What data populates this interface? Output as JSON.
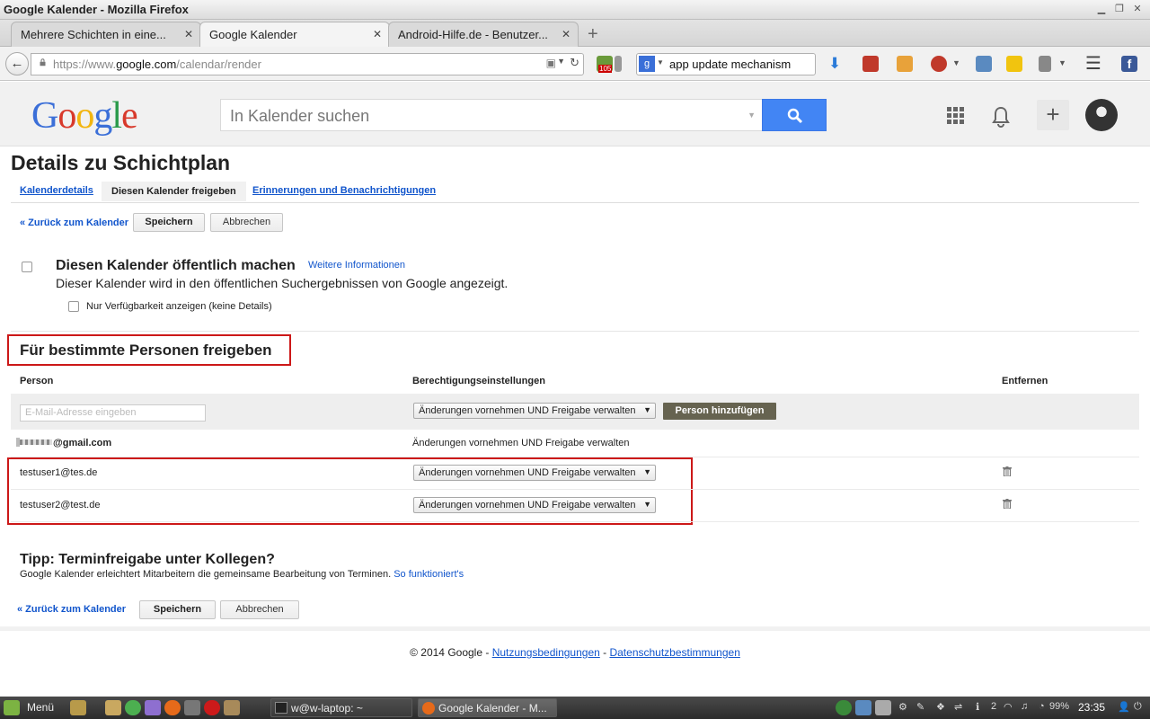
{
  "window": {
    "title": "Google Kalender - Mozilla Firefox"
  },
  "tabs": [
    {
      "label": "Mehrere Schichten in eine...",
      "active": false
    },
    {
      "label": "Google Kalender",
      "active": true
    },
    {
      "label": "Android-Hilfe.de - Benutzer...",
      "active": false
    }
  ],
  "nav": {
    "url_prefix": "https://www.",
    "url_host": "google.com",
    "url_path": "/calendar/render",
    "search_value": "app update mechanism",
    "badge_count": "105"
  },
  "google": {
    "logo": "Google",
    "search_placeholder": "In Kalender suchen"
  },
  "page": {
    "title": "Details zu Schichtplan",
    "tabs": [
      "Kalenderdetails",
      "Diesen Kalender freigeben",
      "Erinnerungen und Benachrichtigungen"
    ],
    "back_link": "« Zurück zum Kalender",
    "save": "Speichern",
    "cancel": "Abbrechen"
  },
  "public": {
    "heading": "Diesen Kalender öffentlich machen",
    "more_info": "Weitere Informationen",
    "description": "Dieser Kalender wird in den öffentlichen Suchergebnissen von Google angezeigt.",
    "availability_only": "Nur Verfügbarkeit anzeigen (keine Details)"
  },
  "share": {
    "heading": "Für bestimmte Personen freigeben",
    "col_person": "Person",
    "col_permission": "Berechtigungseinstellungen",
    "col_remove": "Entfernen",
    "email_placeholder": "E-Mail-Adresse eingeben",
    "new_permission": "Änderungen vornehmen UND Freigabe verwalten",
    "add_person": "Person hinzufügen",
    "owner": {
      "email": "@gmail.com",
      "permission": "Änderungen vornehmen UND Freigabe verwalten"
    },
    "users": [
      {
        "email": "testuser1@tes.de",
        "permission": "Änderungen vornehmen UND Freigabe verwalten"
      },
      {
        "email": "testuser2@test.de",
        "permission": "Änderungen vornehmen UND Freigabe verwalten"
      }
    ]
  },
  "tip": {
    "title": "Tipp: Terminfreigabe unter Kollegen?",
    "text": "Google Kalender erleichtert Mitarbeitern die gemeinsame Bearbeitung von Terminen.",
    "link": "So funktioniert's"
  },
  "footer": {
    "copyright": "© 2014 Google - ",
    "terms": "Nutzungsbedingungen",
    "sep": " - ",
    "privacy": "Datenschutzbestimmungen"
  },
  "taskbar": {
    "menu": "Menü",
    "tasks": [
      "w@w-laptop: ~",
      "Google Kalender - M..."
    ],
    "workspace": "2",
    "battery": "99%",
    "clock": "23:35"
  }
}
